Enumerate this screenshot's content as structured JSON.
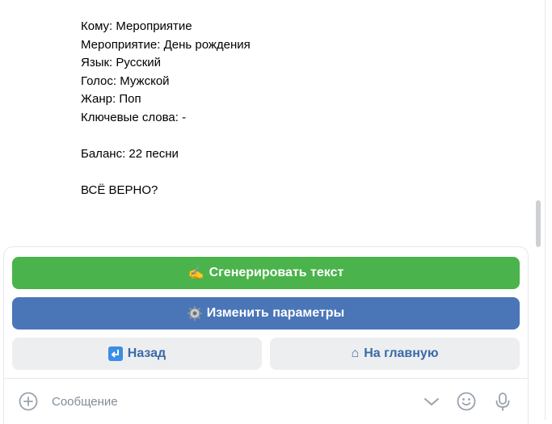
{
  "message": {
    "lines": [
      "Кому: Мероприятие",
      "Мероприятие: День рождения",
      "Язык: Русский",
      "Голос: Мужской",
      "Жанр: Поп",
      "Ключевые слова: -",
      "",
      "Баланс: 22 песни",
      "",
      "ВСЁ ВЕРНО?"
    ]
  },
  "keyboard": {
    "generate": {
      "emoji": "✍️",
      "label": "Сгенерировать текст",
      "color": "#4bb34b",
      "icon": "writing-hand-icon"
    },
    "params": {
      "emoji": "⚙️",
      "label": "Изменить параметры",
      "color": "#4a76b8",
      "icon": "gear-icon"
    },
    "back": {
      "emoji": "↩",
      "label": "Назад",
      "icon": "return-arrow-icon"
    },
    "home": {
      "emoji": "⌂",
      "label": "На главную",
      "icon": "house-icon"
    }
  },
  "composer": {
    "placeholder": "Сообщение"
  }
}
